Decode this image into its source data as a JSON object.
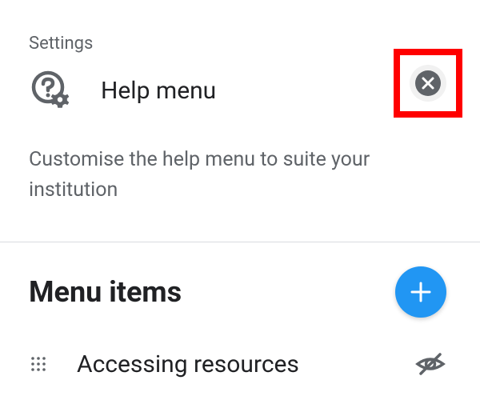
{
  "breadcrumb": "Settings",
  "header": {
    "title": "Help menu"
  },
  "description": "Customise the help menu to suite your institution",
  "section": {
    "title": "Menu items"
  },
  "items": [
    {
      "label": "Accessing resources"
    }
  ]
}
